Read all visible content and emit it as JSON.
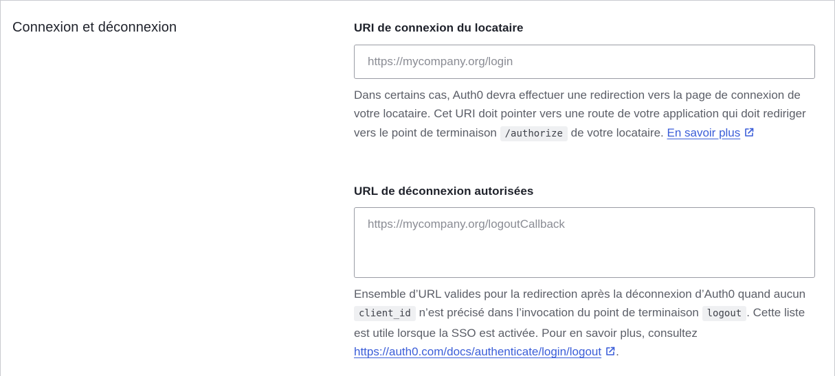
{
  "section": {
    "title": "Connexion et déconnexion"
  },
  "login_uri": {
    "label": "URI de connexion du locataire",
    "placeholder": "https://mycompany.org/login",
    "value": "",
    "help_part1": "Dans certains cas, Auth0 devra effectuer une redirection vers la page de connexion de votre locataire. Cet URI doit pointer vers une route de votre application qui doit rediriger vers le point de terminaison ",
    "help_code": "/authorize",
    "help_part2": " de votre locataire. ",
    "link_label": "En savoir plus",
    "link_icon": "external-link-icon"
  },
  "logout_urls": {
    "label": "URL de déconnexion autorisées",
    "placeholder": "https://mycompany.org/logoutCallback",
    "value": "",
    "help_part1": "Ensemble d’URL valides pour la redirection après la déconnexion d’Auth0 quand aucun ",
    "help_code1": "client_id",
    "help_part2": " n’est précisé dans l’invocation du point de terminaison ",
    "help_code2": "logout",
    "help_part3": ". Cette liste est utile lorsque la SSO est activée. Pour en savoir plus, consultez ",
    "link_label": "https://auth0.com/docs/authenticate/login/logout",
    "link_icon": "external-link-icon",
    "help_end": "."
  },
  "colors": {
    "link": "#3a5dd8",
    "text": "#1e212a",
    "muted": "#5b5e67",
    "border": "#999ba3"
  }
}
